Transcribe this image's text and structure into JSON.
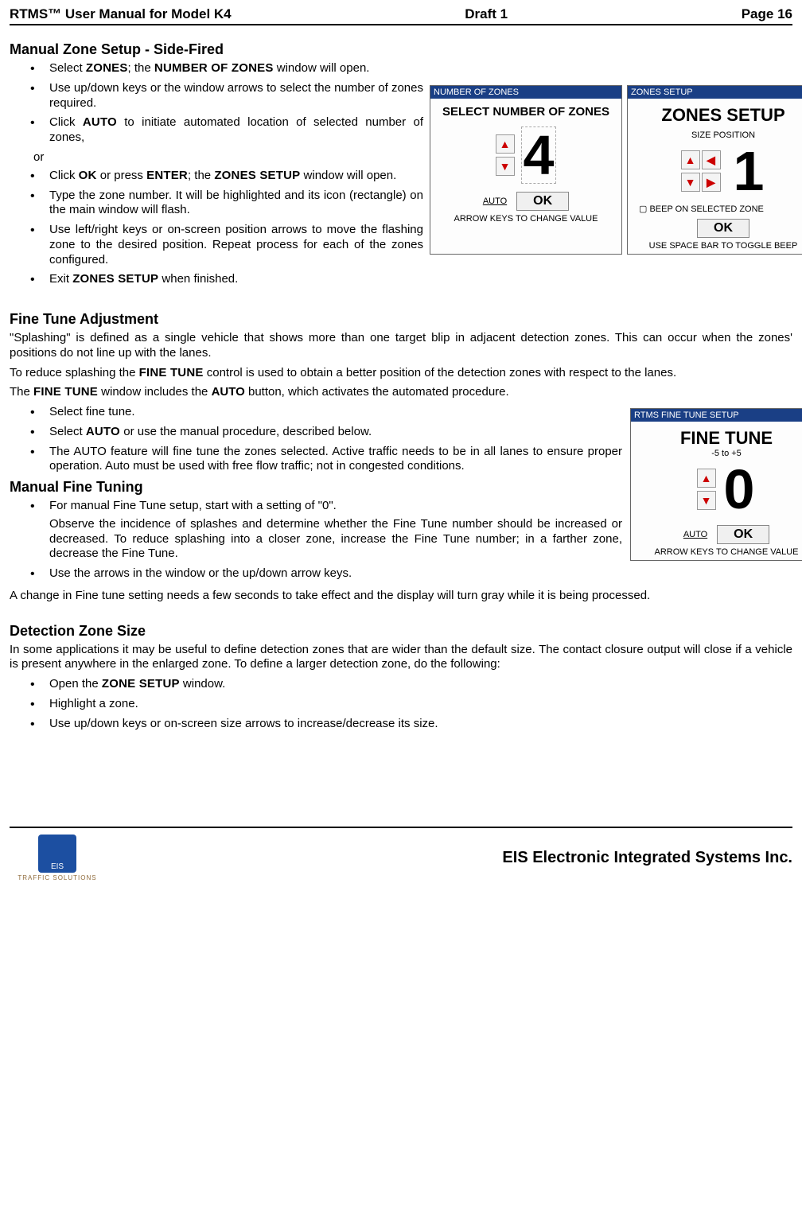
{
  "header": {
    "left": "RTMS™  User Manual for Model K4",
    "center": "Draft 1",
    "right": "Page 16"
  },
  "sections": {
    "manual_zone": {
      "title": "Manual Zone Setup - Side-Fired",
      "items": {
        "i1a": "Select ",
        "i1b": "ZONES",
        "i1c": "; the ",
        "i1d": "NUMBER OF ZONES",
        "i1e": " window will open.",
        "i2": "Use up/down keys or the window arrows to select the number of zones required.",
        "i3a": "Click ",
        "i3b": "AUTO",
        "i3c": " to initiate automated location of selected number of zones,",
        "or": "or",
        "i4a": "Click ",
        "i4b": "OK",
        "i4c": " or press ",
        "i4d": "ENTER",
        "i4e": "; the ",
        "i4f": "ZONES SETUP",
        "i4g": " window will open.",
        "i5": "Type the zone number.  It will be highlighted and its icon (rectangle) on the main window will flash.",
        "i6": "Use left/right keys or on-screen position arrows to move the flashing zone to the desired position.  Repeat process for each of the zones configured.",
        "i7a": "Exit ",
        "i7b": "ZONES SETUP",
        "i7c": " when finished."
      },
      "panel_num": {
        "titlebar": "NUMBER OF ZONES",
        "heading": "SELECT NUMBER OF ZONES",
        "value": "4",
        "auto": "AUTO",
        "ok": "OK",
        "footer": "ARROW KEYS TO CHANGE VALUE"
      },
      "panel_zones": {
        "titlebar": "ZONES SETUP",
        "heading": "ZONES SETUP",
        "sub": "SIZE   POSITION",
        "value": "1",
        "beep": "BEEP ON SELECTED ZONE",
        "ok": "OK",
        "footer": "USE SPACE BAR TO TOGGLE BEEP"
      }
    },
    "fine_tune": {
      "title": "Fine Tune Adjustment",
      "p1": " \"Splashing\" is defined as a single vehicle that shows more than one target blip in adjacent detection zones. This can occur when the zones' positions do not line up with the lanes.",
      "p2a": "To reduce splashing the ",
      "p2b": "FINE TUNE",
      "p2c": " control is used to obtain a better position of the detection zones with respect to the lanes.",
      "p3a": "The ",
      "p3b": "FINE TUNE",
      "p3c": " window includes the ",
      "p3d": "AUTO",
      "p3e": " button, which activates the automated procedure.",
      "items": {
        "i1": "Select fine tune.",
        "i2a": "Select ",
        "i2b": "AUTO ",
        "i2c": "or use the manual procedure, described below.",
        "i3": "The AUTO feature will fine tune the zones selected. Active traffic needs to be in all lanes to ensure proper operation. Auto must be used with free flow traffic; not in congested conditions."
      },
      "panel": {
        "titlebar": "RTMS FINE TUNE SETUP",
        "heading": "FINE TUNE",
        "range": "-5 to +5",
        "value": "0",
        "auto": "AUTO",
        "ok": "OK",
        "footer": "ARROW KEYS TO CHANGE VALUE"
      }
    },
    "manual_fine": {
      "title": "Manual Fine Tuning",
      "items": {
        "i1": "For manual Fine Tune setup, start with a setting of \"0\".",
        "i1sub": "Observe the incidence of splashes and determine whether the Fine Tune number should be increased or decreased. To reduce splashing into a closer zone, increase the Fine Tune number; in a farther zone, decrease the Fine Tune.",
        "i2": "Use the arrows in the window or the up/down arrow keys."
      },
      "p1": "A change in Fine tune setting needs a few seconds to take effect and the display will turn gray while it is being processed."
    },
    "det_zone": {
      "title": "Detection Zone Size",
      "p1": "In some applications it may be useful to define detection zones that are wider than the default size.  The contact closure output will close if a vehicle is present anywhere in the enlarged zone. To define a larger detection zone, do the following:",
      "items": {
        "i1a": "Open the ",
        "i1b": "ZONE SETUP",
        "i1c": " window.",
        "i2": "Highlight a zone.",
        "i3": "Use up/down keys or on-screen size arrows to increase/decrease its size."
      }
    }
  },
  "footer": {
    "logo_sub": "TRAFFIC SOLUTIONS",
    "company": "EIS Electronic Integrated Systems Inc."
  }
}
